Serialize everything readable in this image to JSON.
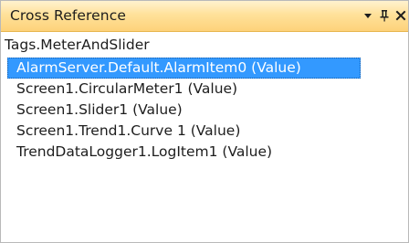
{
  "panel": {
    "title": "Cross Reference",
    "buttons": {
      "menu_icon": "chevron-down-icon",
      "pin_icon": "pin-icon",
      "close_icon": "close-icon"
    }
  },
  "source": {
    "label": "Tags.MeterAndSlider"
  },
  "references": {
    "items": [
      {
        "label": "AlarmServer.Default.AlarmItem0 (Value)",
        "selected": true
      },
      {
        "label": "Screen1.CircularMeter1 (Value)",
        "selected": false
      },
      {
        "label": "Screen1.Slider1 (Value)",
        "selected": false
      },
      {
        "label": "Screen1.Trend1.Curve 1 (Value)",
        "selected": false
      },
      {
        "label": "TrendDataLogger1.LogItem1 (Value)",
        "selected": false
      }
    ]
  },
  "colors": {
    "titlebar_accent": "#fdd27a",
    "selection": "#3399ff"
  }
}
